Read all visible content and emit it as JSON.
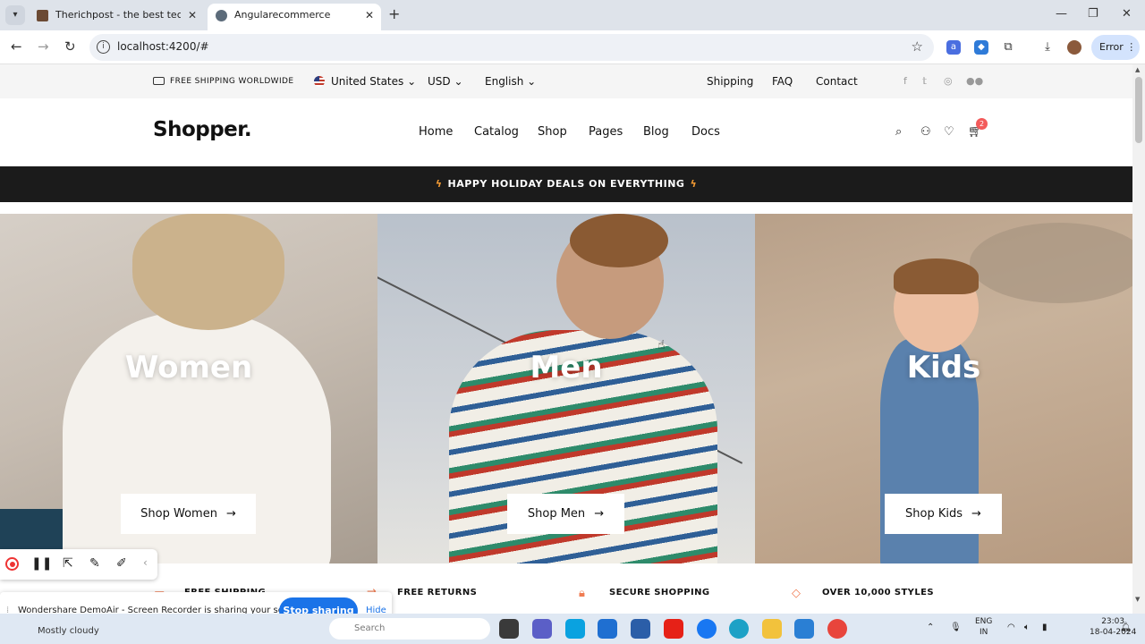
{
  "browser": {
    "tabs": [
      {
        "title": "Therichpost - the best tech an",
        "active": false
      },
      {
        "title": "Angularecommerce",
        "active": true
      }
    ],
    "url": "localhost:4200/#",
    "error_label": "Error"
  },
  "topbar": {
    "shipping_note": "FREE SHIPPING WORLDWIDE",
    "country": "United States",
    "currency": "USD",
    "language": "English",
    "links": [
      "Shipping",
      "FAQ",
      "Contact"
    ],
    "social_icons": [
      "facebook-icon",
      "twitter-icon",
      "instagram-icon",
      "medium-icon"
    ]
  },
  "header": {
    "logo": "Shopper.",
    "nav": [
      "Home",
      "Catalog",
      "Shop",
      "Pages",
      "Blog",
      "Docs"
    ],
    "cart_count": "2"
  },
  "promo": {
    "text": "HAPPY HOLIDAY DEALS ON EVERYTHING"
  },
  "hero": {
    "panels": [
      {
        "title": "Women",
        "button": "Shop Women"
      },
      {
        "title": "Men",
        "button": "Shop Men"
      },
      {
        "title": "Kids",
        "button": "Shop Kids"
      }
    ]
  },
  "features": [
    {
      "title": "FREE SHIPPING",
      "icon": "truck-icon"
    },
    {
      "title": "FREE RETURNS",
      "icon": "returns-icon"
    },
    {
      "title": "SECURE SHOPPING",
      "icon": "lock-icon"
    },
    {
      "title": "OVER 10,000 STYLES",
      "icon": "tag-icon"
    }
  ],
  "sharing": {
    "message": "Wondershare DemoAir - Screen Recorder is sharing your screen.",
    "stop_label": "Stop sharing",
    "hide_label": "Hide"
  },
  "taskbar": {
    "weather": "Mostly cloudy",
    "search_placeholder": "Search",
    "lang_line1": "ENG",
    "lang_line2": "IN",
    "time": "23:03",
    "date": "18-04-2024"
  },
  "colors": {
    "accent": "#f07c52",
    "promo_bg": "#1b1b1b",
    "badge": "#f35b5b",
    "stop_button": "#1a73e8"
  }
}
